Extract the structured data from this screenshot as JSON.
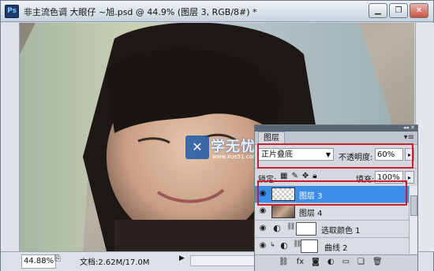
{
  "window": {
    "app_icon": "Ps",
    "title": "非主流色调   大眼仔 ~旭.psd @ 44.9% (图层 3, RGB/8#) *",
    "buttons": [
      "minimize",
      "restore",
      "close"
    ]
  },
  "canvas": {
    "watermark": {
      "logo_glyph": "✕",
      "text": "学无忧",
      "url": "www.xue51.com"
    }
  },
  "statusbar": {
    "zoom": "44.88%",
    "doc_size": "文档:2.62M/17.0M"
  },
  "layers_panel": {
    "tab_label": "图层",
    "blend_mode": "正片叠底",
    "opacity_label": "不透明度:",
    "opacity_value": "60%",
    "lock_label": "锁定:",
    "fill_label": "填充:",
    "fill_value": "100%",
    "layers": [
      {
        "name": "图层 3",
        "selected": true,
        "kind": "pixel-transparent"
      },
      {
        "name": "图层 4",
        "selected": false,
        "kind": "pixel-photo"
      },
      {
        "name": "选取颜色 1",
        "selected": false,
        "kind": "adjustment"
      },
      {
        "name": "曲线 2",
        "selected": false,
        "kind": "adjustment"
      }
    ]
  },
  "colors": {
    "selected_layer": "#3d8ee8",
    "highlight_red": "#c8202a",
    "watermark_blue": "#1f5aa8"
  }
}
